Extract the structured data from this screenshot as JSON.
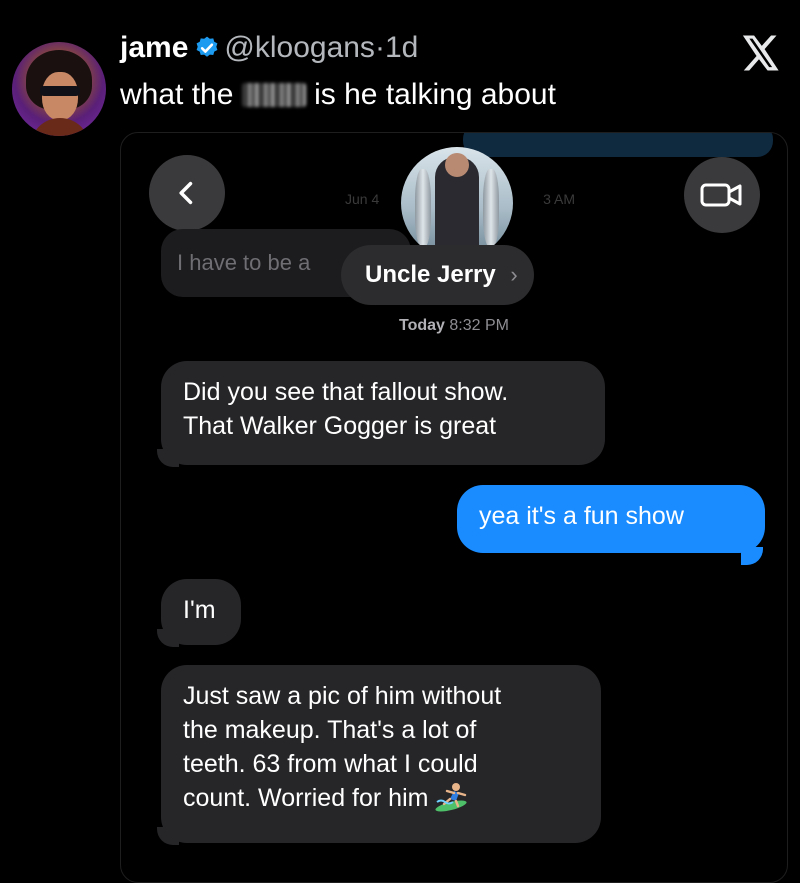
{
  "tweet": {
    "name": "jame",
    "handle": "@kloogans",
    "separator": "·",
    "time": "1d",
    "text_before": "what the",
    "censored_word": "fuck",
    "text_after": "is he talking about",
    "platform_icon": "x-logo-icon"
  },
  "screenshot": {
    "contact_name": "Uncle Jerry",
    "faded_previous_text": "I have to be a",
    "faded_date_left": "Jun 4",
    "faded_date_right": "3 AM",
    "timestamp_day": "Today",
    "timestamp_time": "8:32 PM",
    "messages": [
      {
        "from": "them",
        "line1": "Did you see that fallout show.",
        "line2": "That Walker Gogger is great"
      },
      {
        "from": "me",
        "line1": "yea it's a fun show"
      },
      {
        "from": "them",
        "line1": "I'm"
      },
      {
        "from": "them",
        "line1": "Just saw a pic of him without",
        "line2": "the makeup. That's a lot of",
        "line3": "teeth. 63 from what I could",
        "line4": "count. Worried for him",
        "emoji": "surfer-emoji"
      }
    ]
  },
  "colors": {
    "background": "#000000",
    "incoming_bubble": "#262629",
    "outgoing_bubble": "#1a8cff",
    "verified": "#1d9bf0",
    "muted_text": "#b4b8bd"
  }
}
